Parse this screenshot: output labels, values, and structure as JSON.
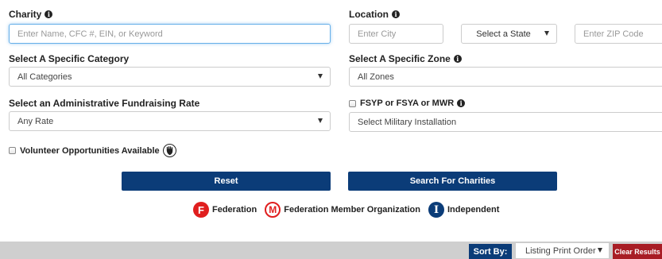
{
  "charity": {
    "label": "Charity",
    "placeholder": "Enter Name, CFC #, EIN, or Keyword"
  },
  "location": {
    "label": "Location",
    "city_placeholder": "Enter City",
    "state_value": "Select a State",
    "zip_placeholder": "Enter ZIP Code"
  },
  "category": {
    "label": "Select A Specific Category",
    "value": "All Categories"
  },
  "zone": {
    "label": "Select A Specific Zone",
    "value": "All Zones"
  },
  "rate": {
    "label": "Select an Administrative Fundraising Rate",
    "value": "Any Rate"
  },
  "military": {
    "checkbox_label": "FSYP or FSYA or MWR",
    "value": "Select Military Installation"
  },
  "volunteer": {
    "label": "Volunteer Opportunities Available"
  },
  "buttons": {
    "reset": "Reset",
    "search": "Search For Charities"
  },
  "legend": {
    "federation": {
      "glyph": "F",
      "label": "Federation"
    },
    "member": {
      "glyph": "M",
      "label": "Federation Member Organization"
    },
    "independent": {
      "glyph": "I",
      "label": "Independent"
    }
  },
  "results_bar": {
    "sort_label": "Sort By:",
    "sort_value": "Listing Print Order",
    "clear_label": "Clear Results"
  },
  "colors": {
    "primary": "#0b3c78",
    "danger": "#a81d25",
    "federation_red": "#e01e1e",
    "focus_border": "#66afe9"
  },
  "icons": {
    "info": "info-icon",
    "hand": "hand-icon",
    "caret": "caret-down-icon"
  }
}
